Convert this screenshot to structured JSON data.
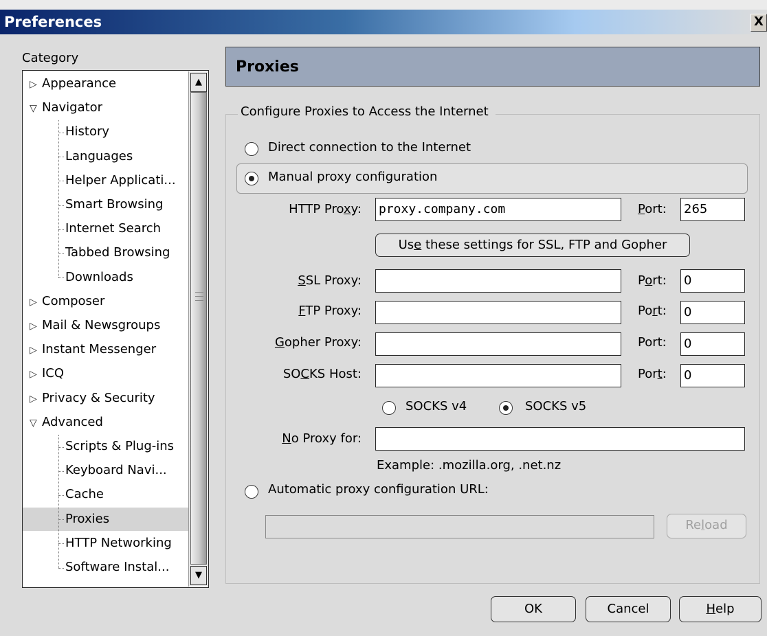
{
  "window": {
    "title": "Preferences",
    "close_glyph": "X"
  },
  "category": {
    "label": "Category",
    "tree": [
      {
        "label": "Appearance",
        "level": 0,
        "state": "collapsed"
      },
      {
        "label": "Navigator",
        "level": 0,
        "state": "expanded"
      },
      {
        "label": "History",
        "level": 1
      },
      {
        "label": "Languages",
        "level": 1
      },
      {
        "label": "Helper Applicati...",
        "level": 1
      },
      {
        "label": "Smart Browsing",
        "level": 1
      },
      {
        "label": "Internet Search",
        "level": 1
      },
      {
        "label": "Tabbed Browsing",
        "level": 1
      },
      {
        "label": "Downloads",
        "level": 1
      },
      {
        "label": "Composer",
        "level": 0,
        "state": "collapsed"
      },
      {
        "label": "Mail & Newsgroups",
        "level": 0,
        "state": "collapsed"
      },
      {
        "label": "Instant Messenger",
        "level": 0,
        "state": "collapsed"
      },
      {
        "label": "ICQ",
        "level": 0,
        "state": "collapsed"
      },
      {
        "label": "Privacy & Security",
        "level": 0,
        "state": "collapsed"
      },
      {
        "label": "Advanced",
        "level": 0,
        "state": "expanded"
      },
      {
        "label": "Scripts & Plug-ins",
        "level": 1
      },
      {
        "label": "Keyboard Navi...",
        "level": 1
      },
      {
        "label": "Cache",
        "level": 1
      },
      {
        "label": "Proxies",
        "level": 1,
        "selected": true
      },
      {
        "label": "HTTP Networking",
        "level": 1
      },
      {
        "label": "Software Instal...",
        "level": 1
      }
    ]
  },
  "panel": {
    "title": "Proxies",
    "group_label": "Configure Proxies to Access the Internet",
    "direct": {
      "label": "Direct connection to the Internet",
      "selected": false
    },
    "manual": {
      "label": "Manual proxy configuration",
      "selected": true
    },
    "http": {
      "label_pre": "HTTP Pro",
      "label_key": "x",
      "label_post": "y:",
      "value": "proxy.company.com",
      "port_pre": "",
      "port_key": "P",
      "port_post": "ort:",
      "port": "265"
    },
    "use_same": {
      "pre": "Us",
      "key": "e",
      "post": " these settings for SSL, FTP and Gopher"
    },
    "ssl": {
      "label_pre": "",
      "label_key": "S",
      "label_post": "SL Proxy:",
      "value": "",
      "port_pre": "P",
      "port_key": "o",
      "port_post": "rt:",
      "port": "0"
    },
    "ftp": {
      "label_pre": "",
      "label_key": "F",
      "label_post": "TP Proxy:",
      "value": "",
      "port_pre": "Po",
      "port_key": "r",
      "port_post": "t:",
      "port": "0"
    },
    "gopher": {
      "label_pre": "",
      "label_key": "G",
      "label_post": "opher Proxy:",
      "value": "",
      "port_pre": "Port:",
      "port_key": "",
      "port_post": "",
      "port": "0"
    },
    "socks": {
      "label_pre": "SO",
      "label_key": "C",
      "label_post": "KS Host:",
      "value": "",
      "port_pre": "Por",
      "port_key": "t",
      "port_post": ":",
      "port": "0",
      "v4_label": "SOCKS v4",
      "v4_selected": false,
      "v5_label": "SOCKS v5",
      "v5_selected": true
    },
    "no_proxy": {
      "label_pre": "",
      "label_key": "N",
      "label_post": "o Proxy for:",
      "value": "",
      "example": "Example: .mozilla.org, .net.nz"
    },
    "auto": {
      "label": "Automatic proxy configuration URL:",
      "selected": false,
      "value": "",
      "reload_pre": "Re",
      "reload_key": "l",
      "reload_post": "oad"
    }
  },
  "footer": {
    "ok": "OK",
    "cancel": "Cancel",
    "help_key": "H",
    "help_post": "elp"
  }
}
